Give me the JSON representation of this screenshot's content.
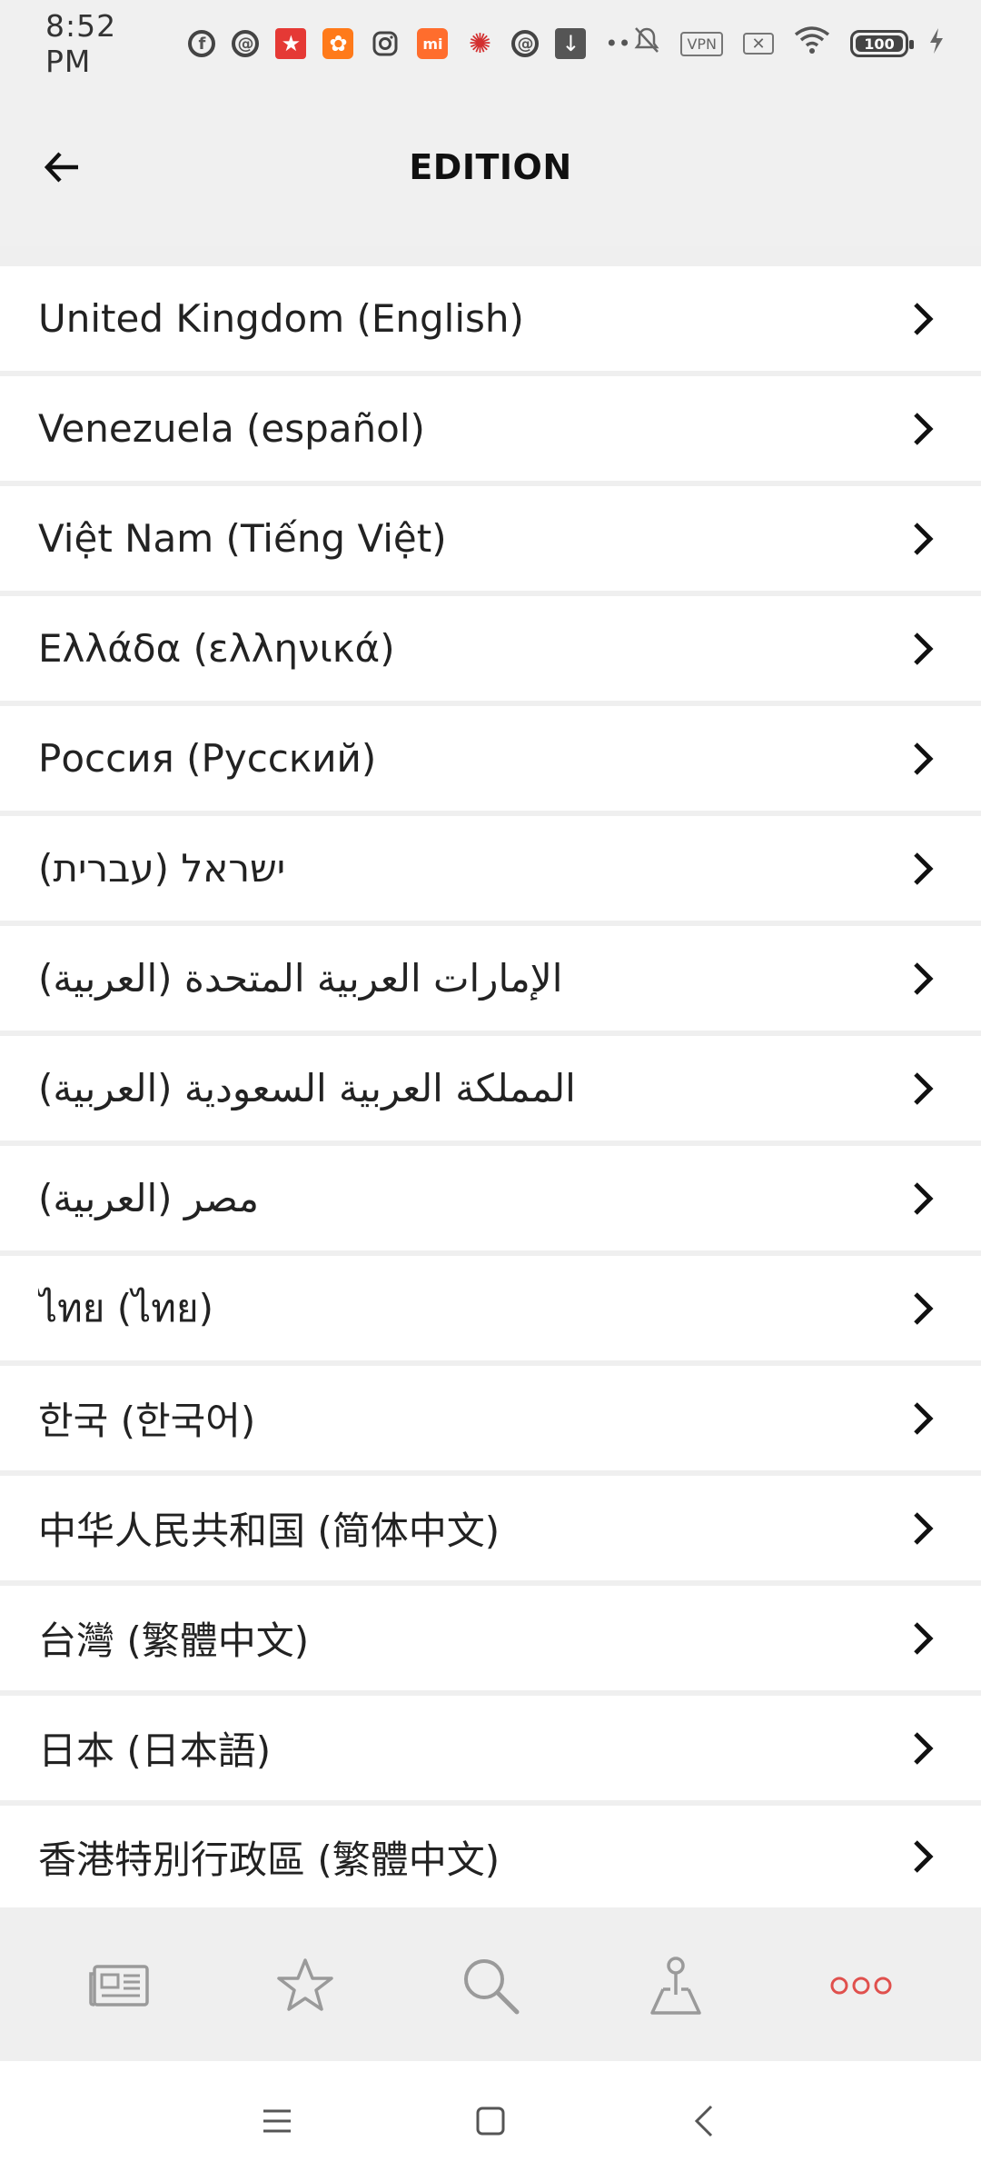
{
  "status_bar": {
    "time": "8:52 PM",
    "vpn_label": "VPN",
    "battery_level": "100",
    "icons": [
      "facebook-icon",
      "notification-app-icon",
      "app-icon",
      "app-icon",
      "instagram-icon",
      "mi-icon",
      "app-icon",
      "notification-app-icon",
      "download-icon",
      "more-dots-icon"
    ],
    "right_icons": [
      "mute-icon",
      "vpn-icon",
      "sim-disabled-icon",
      "wifi-icon",
      "battery-icon",
      "charging-icon"
    ]
  },
  "app_bar": {
    "title": "EDITION"
  },
  "editions": [
    {
      "label": "United Kingdom (English)"
    },
    {
      "label": "Venezuela (español)"
    },
    {
      "label": "Việt Nam (Tiếng Việt)"
    },
    {
      "label": "Ελλάδα (ελληνικά)"
    },
    {
      "label": "Россия (Русский)"
    },
    {
      "label": "ישראל (עברית)"
    },
    {
      "label": "الإمارات العربية المتحدة (العربية)"
    },
    {
      "label": "المملكة العربية السعودية (العربية)"
    },
    {
      "label": "مصر (العربية)"
    },
    {
      "label": "ไทย (ไทย)"
    },
    {
      "label": "한국 (한국어)"
    },
    {
      "label": "中华人民共和国 (简体中文)"
    },
    {
      "label": "台灣 (繁體中文)"
    },
    {
      "label": "日本 (日本語)"
    },
    {
      "label": "香港特別行政區 (繁體中文)"
    }
  ],
  "bottom_nav": [
    "newspaper-icon",
    "star-icon",
    "search-icon",
    "map-marker-icon",
    "more-icon"
  ],
  "colors": {
    "background": "#f0f0f0",
    "accent": "#e0504d"
  }
}
